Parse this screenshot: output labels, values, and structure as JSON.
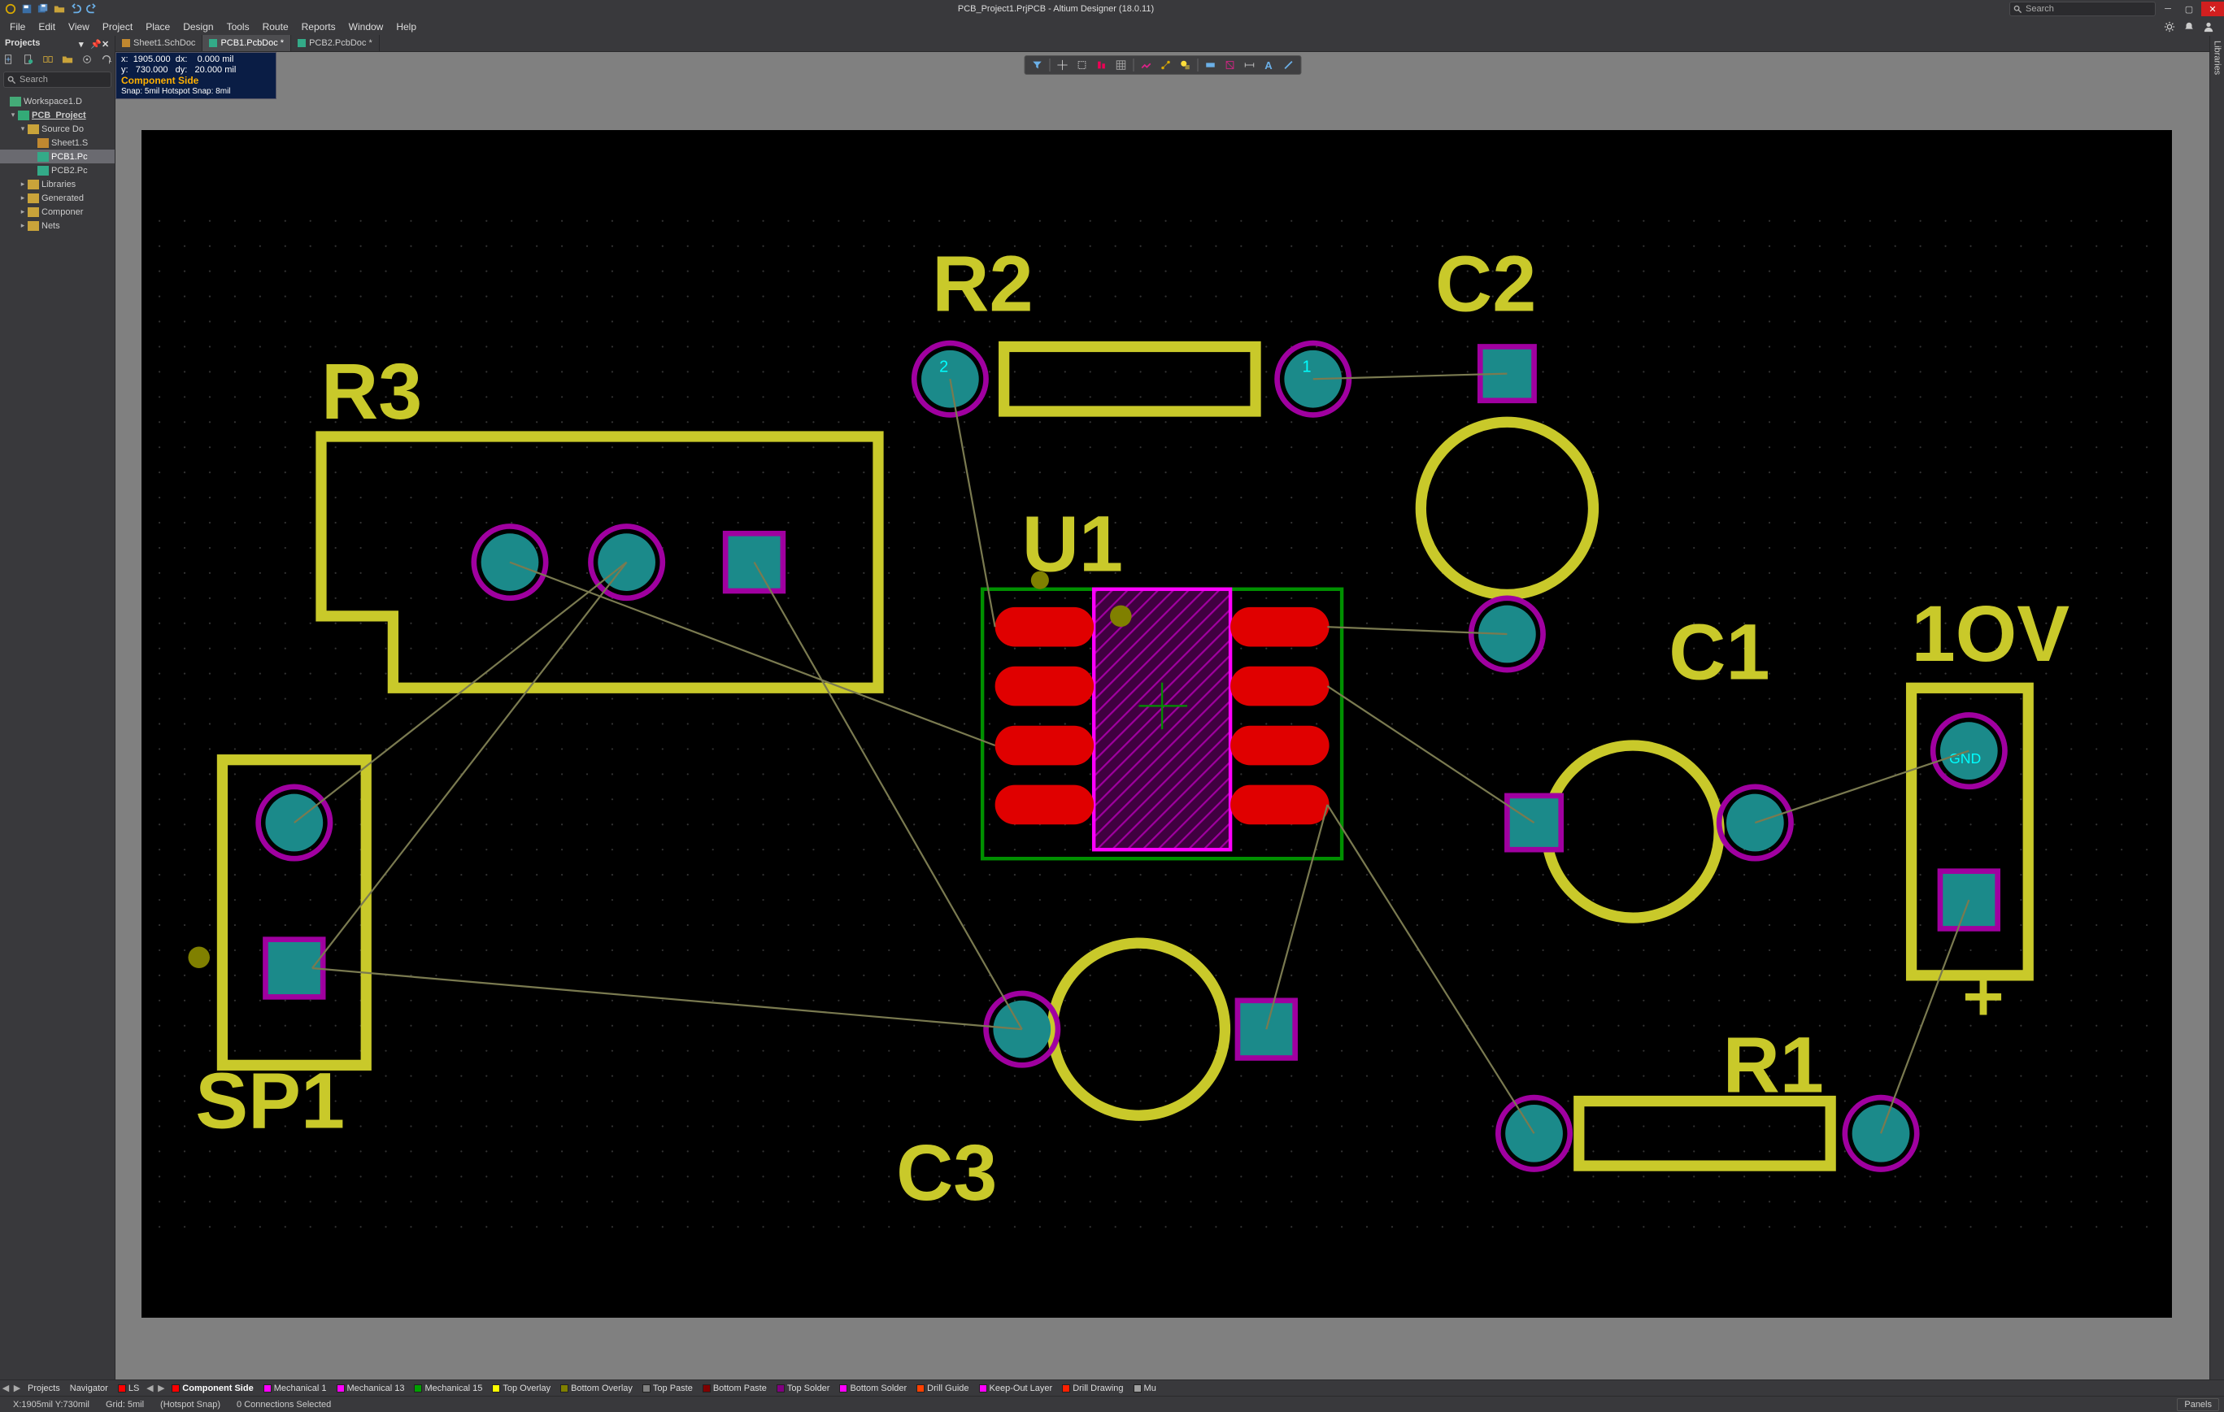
{
  "title": "PCB_Project1.PrjPCB - Altium Designer (18.0.11)",
  "quick_toolbar": [
    "app-logo",
    "save",
    "save-all",
    "open",
    "undo",
    "redo"
  ],
  "search_placeholder": "Search",
  "menu": [
    "File",
    "Edit",
    "View",
    "Project",
    "Place",
    "Design",
    "Tools",
    "Route",
    "Reports",
    "Window",
    "Help"
  ],
  "right_icons": [
    "settings",
    "notifications",
    "user"
  ],
  "projects_panel": {
    "title": "Projects",
    "hdr_icons": [
      "pin",
      "dropdown",
      "close"
    ],
    "toolbar_icons": [
      "new",
      "compile",
      "show-diff",
      "open-project",
      "locate",
      "refresh"
    ],
    "search_placeholder": "Search",
    "tree": [
      {
        "lvl": 0,
        "tw": "",
        "icon": "workspace",
        "label": "Workspace1.D",
        "sel": false
      },
      {
        "lvl": 1,
        "tw": "▾",
        "icon": "project",
        "label": "PCB_Project",
        "sel": false,
        "bold": true
      },
      {
        "lvl": 2,
        "tw": "▾",
        "icon": "folder",
        "label": "Source Do",
        "sel": false
      },
      {
        "lvl": 3,
        "tw": "",
        "icon": "sch",
        "label": "Sheet1.S",
        "sel": false
      },
      {
        "lvl": 3,
        "tw": "",
        "icon": "pcb",
        "label": "PCB1.Pc",
        "sel": true
      },
      {
        "lvl": 3,
        "tw": "",
        "icon": "pcb",
        "label": "PCB2.Pc",
        "sel": false
      },
      {
        "lvl": 2,
        "tw": "▸",
        "icon": "folder",
        "label": "Libraries",
        "sel": false
      },
      {
        "lvl": 2,
        "tw": "▸",
        "icon": "folder",
        "label": "Generated",
        "sel": false
      },
      {
        "lvl": 2,
        "tw": "▸",
        "icon": "folder",
        "label": "Componer",
        "sel": false
      },
      {
        "lvl": 2,
        "tw": "▸",
        "icon": "folder",
        "label": "Nets",
        "sel": false
      }
    ]
  },
  "tabs": [
    {
      "label": "Sheet1.SchDoc",
      "type": "sch",
      "active": false,
      "dirty": false
    },
    {
      "label": "PCB1.PcbDoc *",
      "type": "pcb",
      "active": true,
      "dirty": true
    },
    {
      "label": "PCB2.PcbDoc *",
      "type": "pcb",
      "active": false,
      "dirty": true
    }
  ],
  "hud": {
    "x_label": "x:",
    "x_val": "1905.000",
    "dx_label": "dx:",
    "dx_val": "0.000",
    "unit": "mil",
    "y_label": "y:",
    "y_val": "730.000",
    "dy_label": "dy:",
    "dy_val": "20.000",
    "side": "Component Side",
    "snap": "Snap: 5mil Hotspot Snap: 8mil"
  },
  "floating_tools": [
    "filter",
    "cross",
    "marquee",
    "align",
    "grid",
    "sep",
    "net",
    "highlight",
    "mask",
    "sep",
    "diff-pair",
    "via",
    "dimension",
    "text",
    "line"
  ],
  "designators": {
    "R2": "R2",
    "R3": "R3",
    "C1": "C1",
    "C2": "C2",
    "C3": "C3",
    "U1": "U1",
    "R1": "R1",
    "SP1": "SP1",
    "TENV": "1OV"
  },
  "right_panel": {
    "label": "Libraries"
  },
  "layers": {
    "left_btns": [
      "◀",
      "▶"
    ],
    "panels": [
      "Projects",
      "Navigator"
    ],
    "ls": "LS",
    "mid_nav": [
      "◀",
      "▶"
    ],
    "items": [
      {
        "color": "#ff0000",
        "label": "Component Side",
        "sel": true
      },
      {
        "color": "#ff00ff",
        "label": "Mechanical 1"
      },
      {
        "color": "#ff00ff",
        "label": "Mechanical 13"
      },
      {
        "color": "#00a000",
        "label": "Mechanical 15"
      },
      {
        "color": "#ffff00",
        "label": "Top Overlay"
      },
      {
        "color": "#808000",
        "label": "Bottom Overlay"
      },
      {
        "color": "#808080",
        "label": "Top Paste"
      },
      {
        "color": "#800000",
        "label": "Bottom Paste"
      },
      {
        "color": "#800080",
        "label": "Top Solder"
      },
      {
        "color": "#ff00ff",
        "label": "Bottom Solder"
      },
      {
        "color": "#ff4000",
        "label": "Drill Guide"
      },
      {
        "color": "#ff00ff",
        "label": "Keep-Out Layer"
      },
      {
        "color": "#ff2000",
        "label": "Drill Drawing"
      },
      {
        "color": "#a0a0a0",
        "label": "Mu"
      }
    ]
  },
  "status": {
    "coord": "X:1905mil Y:730mil",
    "grid": "Grid: 5mil",
    "snap": "(Hotspot Snap)",
    "sel": "0 Connections Selected",
    "panels_btn": "Panels"
  }
}
